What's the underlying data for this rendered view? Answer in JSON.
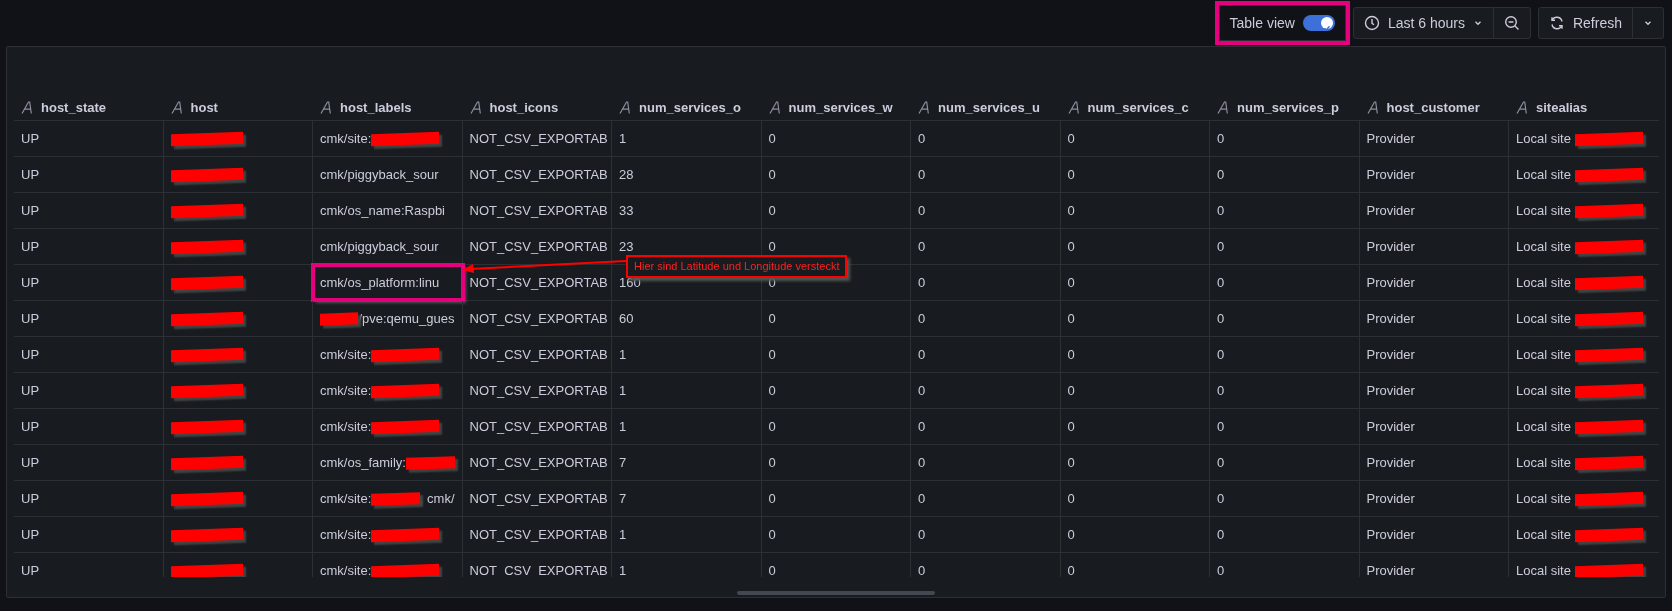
{
  "toolbar": {
    "table_view": {
      "label": "Table view",
      "on": true,
      "highlighted": true
    },
    "time_range": "Last 6 hours",
    "refresh": "Refresh"
  },
  "table": {
    "columns": [
      "host_state",
      "host",
      "host_labels",
      "host_icons",
      "num_services_o",
      "num_services_w",
      "num_services_u",
      "num_services_c",
      "num_services_p",
      "host_customer",
      "sitealias"
    ],
    "rows": [
      {
        "cells": [
          "UP",
          [
            {
              "kind": "redaction"
            }
          ],
          [
            "cmk/site:",
            {
              "kind": "redaction"
            }
          ],
          "NOT_CSV_EXPORTAB",
          "1",
          "0",
          "0",
          "0",
          "0",
          "Provider",
          [
            "Local site ",
            {
              "kind": "redaction"
            }
          ]
        ]
      },
      {
        "cells": [
          "UP",
          [
            {
              "kind": "redaction"
            }
          ],
          "cmk/piggyback_sour",
          "NOT_CSV_EXPORTAB",
          "28",
          "0",
          "0",
          "0",
          "0",
          "Provider",
          [
            "Local site ",
            {
              "kind": "redaction"
            }
          ]
        ]
      },
      {
        "cells": [
          "UP",
          [
            {
              "kind": "redaction"
            }
          ],
          "cmk/os_name:Raspbi",
          "NOT_CSV_EXPORTAB",
          "33",
          "0",
          "0",
          "0",
          "0",
          "Provider",
          [
            "Local site ",
            {
              "kind": "redaction"
            }
          ]
        ]
      },
      {
        "cells": [
          "UP",
          [
            {
              "kind": "redaction"
            }
          ],
          "cmk/piggyback_sour",
          "NOT_CSV_EXPORTAB",
          "23",
          "0",
          "0",
          "0",
          "0",
          "Provider",
          [
            "Local site ",
            {
              "kind": "redaction"
            }
          ]
        ]
      },
      {
        "cells": [
          "UP",
          [
            {
              "kind": "redaction"
            }
          ],
          {
            "text": "cmk/os_platform:linu",
            "highlighted": true
          },
          "NOT_CSV_EXPORTAB",
          "160",
          "0",
          "0",
          "0",
          "0",
          "Provider",
          [
            "Local site ",
            {
              "kind": "redaction"
            }
          ]
        ]
      },
      {
        "cells": [
          "UP",
          [
            {
              "kind": "redaction"
            }
          ],
          [
            {
              "kind": "redaction"
            },
            "/pve:qemu_gues"
          ],
          "NOT_CSV_EXPORTAB",
          "60",
          "0",
          "0",
          "0",
          "0",
          "Provider",
          [
            "Local site ",
            {
              "kind": "redaction"
            }
          ]
        ]
      },
      {
        "cells": [
          "UP",
          [
            {
              "kind": "redaction"
            }
          ],
          [
            "cmk/site:",
            {
              "kind": "redaction"
            }
          ],
          "NOT_CSV_EXPORTAB",
          "1",
          "0",
          "0",
          "0",
          "0",
          "Provider",
          [
            "Local site ",
            {
              "kind": "redaction"
            }
          ]
        ]
      },
      {
        "cells": [
          "UP",
          [
            {
              "kind": "redaction"
            }
          ],
          [
            "cmk/site:",
            {
              "kind": "redaction"
            }
          ],
          "NOT_CSV_EXPORTAB",
          "1",
          "0",
          "0",
          "0",
          "0",
          "Provider",
          [
            "Local site ",
            {
              "kind": "redaction"
            }
          ]
        ]
      },
      {
        "cells": [
          "UP",
          [
            {
              "kind": "redaction"
            }
          ],
          [
            "cmk/site:",
            {
              "kind": "redaction"
            }
          ],
          "NOT_CSV_EXPORTAB",
          "1",
          "0",
          "0",
          "0",
          "0",
          "Provider",
          [
            "Local site ",
            {
              "kind": "redaction"
            }
          ]
        ]
      },
      {
        "cells": [
          "UP",
          [
            {
              "kind": "redaction"
            }
          ],
          [
            "cmk/os_family:",
            {
              "kind": "redaction"
            }
          ],
          "NOT_CSV_EXPORTAB",
          "7",
          "0",
          "0",
          "0",
          "0",
          "Provider",
          [
            "Local site ",
            {
              "kind": "redaction"
            }
          ]
        ]
      },
      {
        "cells": [
          "UP",
          [
            {
              "kind": "redaction"
            }
          ],
          [
            "cmk/site:",
            {
              "kind": "redaction"
            },
            ", cmk/"
          ],
          "NOT_CSV_EXPORTAB",
          "7",
          "0",
          "0",
          "0",
          "0",
          "Provider",
          [
            "Local site ",
            {
              "kind": "redaction"
            }
          ]
        ]
      },
      {
        "cells": [
          "UP",
          [
            {
              "kind": "redaction"
            }
          ],
          [
            "cmk/site:",
            {
              "kind": "redaction"
            }
          ],
          "NOT_CSV_EXPORTAB",
          "1",
          "0",
          "0",
          "0",
          "0",
          "Provider",
          [
            "Local site ",
            {
              "kind": "redaction"
            }
          ]
        ]
      },
      {
        "cells": [
          "UP",
          [
            {
              "kind": "redaction"
            }
          ],
          [
            "cmk/site:",
            {
              "kind": "redaction"
            }
          ],
          "NOT_CSV_EXPORTAB",
          "1",
          "0",
          "0",
          "0",
          "0",
          "Provider",
          [
            "Local site ",
            {
              "kind": "redaction"
            }
          ]
        ]
      }
    ]
  },
  "annotation": {
    "text": "Hier sind Latitude und Longitude versteckt"
  }
}
